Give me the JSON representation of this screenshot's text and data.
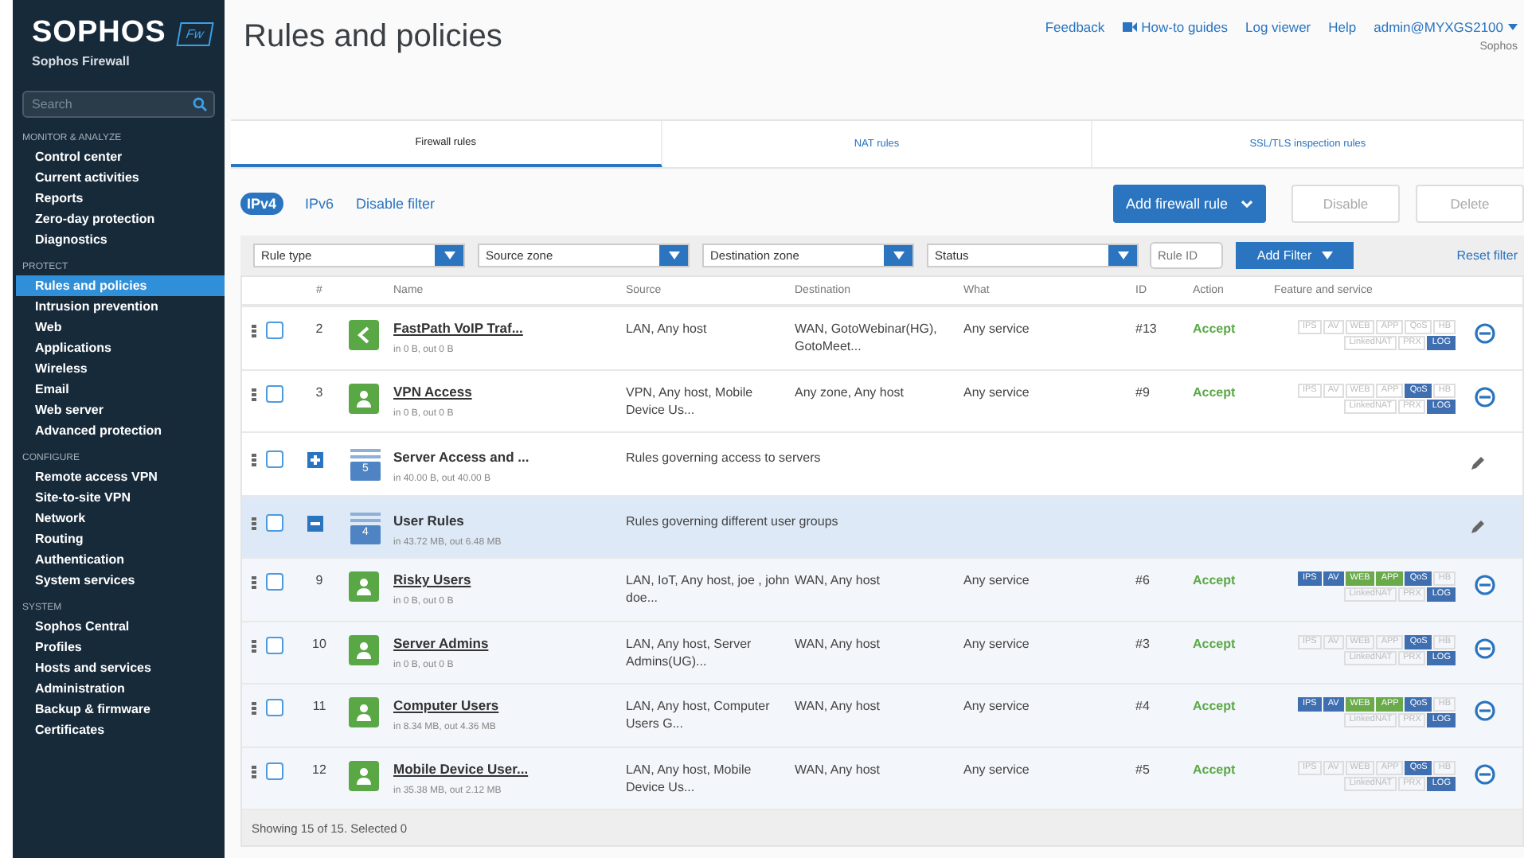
{
  "sidebar": {
    "logo": "SOPHOS",
    "badge": "Fw",
    "product": "Sophos Firewall",
    "search": {
      "placeholder": "Search"
    },
    "sections": [
      {
        "title": "MONITOR & ANALYZE",
        "items": [
          {
            "label": "Control center",
            "selected": false
          },
          {
            "label": "Current activities",
            "selected": false
          },
          {
            "label": "Reports",
            "selected": false
          },
          {
            "label": "Zero-day protection",
            "selected": false
          },
          {
            "label": "Diagnostics",
            "selected": false
          }
        ]
      },
      {
        "title": "PROTECT",
        "items": [
          {
            "label": "Rules and policies",
            "selected": true
          },
          {
            "label": "Intrusion prevention",
            "selected": false
          },
          {
            "label": "Web",
            "selected": false
          },
          {
            "label": "Applications",
            "selected": false
          },
          {
            "label": "Wireless",
            "selected": false
          },
          {
            "label": "Email",
            "selected": false
          },
          {
            "label": "Web server",
            "selected": false
          },
          {
            "label": "Advanced protection",
            "selected": false
          }
        ]
      },
      {
        "title": "CONFIGURE",
        "items": [
          {
            "label": "Remote access VPN",
            "selected": false
          },
          {
            "label": "Site-to-site VPN",
            "selected": false
          },
          {
            "label": "Network",
            "selected": false
          },
          {
            "label": "Routing",
            "selected": false
          },
          {
            "label": "Authentication",
            "selected": false
          },
          {
            "label": "System services",
            "selected": false
          }
        ]
      },
      {
        "title": "SYSTEM",
        "items": [
          {
            "label": "Sophos Central",
            "selected": false
          },
          {
            "label": "Profiles",
            "selected": false
          },
          {
            "label": "Hosts and services",
            "selected": false
          },
          {
            "label": "Administration",
            "selected": false
          },
          {
            "label": "Backup & firmware",
            "selected": false
          },
          {
            "label": "Certificates",
            "selected": false
          }
        ]
      }
    ]
  },
  "header": {
    "title": "Rules and policies",
    "links": [
      {
        "label": "Feedback",
        "kind": "plain"
      },
      {
        "label": "How-to guides",
        "kind": "video"
      },
      {
        "label": "Log viewer",
        "kind": "plain"
      },
      {
        "label": "Help",
        "kind": "plain"
      }
    ],
    "user": "admin@MYXGS2100",
    "company": "Sophos"
  },
  "tabs": [
    {
      "label": "Firewall rules",
      "selected": true
    },
    {
      "label": "NAT rules",
      "selected": false
    },
    {
      "label": "SSL/TLS inspection rules",
      "selected": false
    }
  ],
  "toolbar": {
    "ip_versions": [
      {
        "label": "IPv4",
        "selected": true
      },
      {
        "label": "IPv6",
        "selected": false
      }
    ],
    "disable_filter": "Disable filter",
    "add_button": "Add firewall rule",
    "buttons": [
      {
        "label": "Disable",
        "disabled": true
      },
      {
        "label": "Delete",
        "disabled": true
      }
    ]
  },
  "filters": {
    "dropdowns": [
      "Rule type",
      "Source zone",
      "Destination zone",
      "Status"
    ],
    "rule_id": {
      "placeholder": "Rule ID"
    },
    "add_filter": "Add Filter",
    "reset": "Reset filter"
  },
  "table": {
    "columns": [
      "#",
      "Name",
      "Source",
      "Destination",
      "What",
      "ID",
      "Action",
      "Feature and service"
    ],
    "rows": [
      {
        "kind": "network-rule",
        "checked": false,
        "number": "2",
        "name": "FastPath VoIP Traf...",
        "stats": "in 0 B, out 0 B",
        "source": "LAN, Any host",
        "destination": "WAN, GotoWebinar(HG), GotoMeet...",
        "what": "Any service",
        "id": "#13",
        "action": "Accept",
        "features_top": [
          {
            "label": "IPS",
            "on": false
          },
          {
            "label": "AV",
            "on": false
          },
          {
            "label": "WEB",
            "on": false
          },
          {
            "label": "APP",
            "on": false
          },
          {
            "label": "QoS",
            "on": false
          },
          {
            "label": "HB",
            "on": false
          }
        ],
        "features_bottom": [
          {
            "label": "LinkedNAT",
            "on": false
          },
          {
            "label": "PRX",
            "on": false
          },
          {
            "label": "LOG",
            "on": true,
            "color": "#3f6fb0"
          }
        ]
      },
      {
        "kind": "user-rule",
        "checked": false,
        "number": "3",
        "name": "VPN Access",
        "stats": "in 0 B, out 0 B",
        "source": "VPN, Any host, Mobile Device Us...",
        "destination": "Any zone, Any host",
        "what": "Any service",
        "id": "#9",
        "action": "Accept",
        "features_top": [
          {
            "label": "IPS",
            "on": false
          },
          {
            "label": "AV",
            "on": false
          },
          {
            "label": "WEB",
            "on": false
          },
          {
            "label": "APP",
            "on": false
          },
          {
            "label": "QoS",
            "on": true,
            "color": "#3f6fb0"
          },
          {
            "label": "HB",
            "on": false
          }
        ],
        "features_bottom": [
          {
            "label": "LinkedNAT",
            "on": false
          },
          {
            "label": "PRX",
            "on": false
          },
          {
            "label": "LOG",
            "on": true,
            "color": "#3f6fb0"
          }
        ]
      },
      {
        "kind": "group",
        "checked": false,
        "expanded": false,
        "selected": false,
        "count": "5",
        "name": "Server Access and ...",
        "stats": "in 40.00 B, out 40.00 B",
        "description": "Rules governing access to servers"
      },
      {
        "kind": "group",
        "checked": false,
        "expanded": true,
        "selected": true,
        "count": "4",
        "name": "User Rules",
        "stats": "in 43.72 MB, out 6.48 MB",
        "description": "Rules governing different user groups",
        "children": [
          {
            "kind": "user-rule",
            "checked": false,
            "number": "9",
            "name": "Risky Users",
            "stats": "in 0 B, out 0 B",
            "source": "LAN, IoT, Any host, joe , john doe...",
            "destination": "WAN, Any host",
            "what": "Any service",
            "id": "#6",
            "action": "Accept",
            "features_top": [
              {
                "label": "IPS",
                "on": true,
                "color": "#3f6fb0"
              },
              {
                "label": "AV",
                "on": true,
                "color": "#3f6fb0"
              },
              {
                "label": "WEB",
                "on": true,
                "color": "#6aaa4a"
              },
              {
                "label": "APP",
                "on": true,
                "color": "#6aaa4a"
              },
              {
                "label": "QoS",
                "on": true,
                "color": "#3f6fb0"
              },
              {
                "label": "HB",
                "on": false
              }
            ],
            "features_bottom": [
              {
                "label": "LinkedNAT",
                "on": false
              },
              {
                "label": "PRX",
                "on": false
              },
              {
                "label": "LOG",
                "on": true,
                "color": "#3f6fb0"
              }
            ]
          },
          {
            "kind": "user-rule",
            "checked": false,
            "number": "10",
            "name": "Server Admins",
            "stats": "in 0 B, out 0 B",
            "source": "LAN, Any host, Server Admins(UG)...",
            "destination": "WAN, Any host",
            "what": "Any service",
            "id": "#3",
            "action": "Accept",
            "features_top": [
              {
                "label": "IPS",
                "on": false
              },
              {
                "label": "AV",
                "on": false
              },
              {
                "label": "WEB",
                "on": false
              },
              {
                "label": "APP",
                "on": false
              },
              {
                "label": "QoS",
                "on": true,
                "color": "#3f6fb0"
              },
              {
                "label": "HB",
                "on": false
              }
            ],
            "features_bottom": [
              {
                "label": "LinkedNAT",
                "on": false
              },
              {
                "label": "PRX",
                "on": false
              },
              {
                "label": "LOG",
                "on": true,
                "color": "#3f6fb0"
              }
            ]
          },
          {
            "kind": "user-rule",
            "checked": false,
            "number": "11",
            "name": "Computer Users",
            "stats": "in 8.34 MB, out 4.36 MB",
            "source": "LAN, Any host, Computer Users G...",
            "destination": "WAN, Any host",
            "what": "Any service",
            "id": "#4",
            "action": "Accept",
            "features_top": [
              {
                "label": "IPS",
                "on": true,
                "color": "#3f6fb0"
              },
              {
                "label": "AV",
                "on": true,
                "color": "#3f6fb0"
              },
              {
                "label": "WEB",
                "on": true,
                "color": "#6aaa4a"
              },
              {
                "label": "APP",
                "on": true,
                "color": "#6aaa4a"
              },
              {
                "label": "QoS",
                "on": true,
                "color": "#3f6fb0"
              },
              {
                "label": "HB",
                "on": false
              }
            ],
            "features_bottom": [
              {
                "label": "LinkedNAT",
                "on": false
              },
              {
                "label": "PRX",
                "on": false
              },
              {
                "label": "LOG",
                "on": true,
                "color": "#3f6fb0"
              }
            ]
          },
          {
            "kind": "user-rule",
            "checked": false,
            "number": "12",
            "name": "Mobile Device User...",
            "stats": "in 35.38 MB, out 2.12 MB",
            "source": "LAN, Any host, Mobile Device Us...",
            "destination": "WAN, Any host",
            "what": "Any service",
            "id": "#5",
            "action": "Accept",
            "features_top": [
              {
                "label": "IPS",
                "on": false
              },
              {
                "label": "AV",
                "on": false
              },
              {
                "label": "WEB",
                "on": false
              },
              {
                "label": "APP",
                "on": false
              },
              {
                "label": "QoS",
                "on": true,
                "color": "#3f6fb0"
              },
              {
                "label": "HB",
                "on": false
              }
            ],
            "features_bottom": [
              {
                "label": "LinkedNAT",
                "on": false
              },
              {
                "label": "PRX",
                "on": false
              },
              {
                "label": "LOG",
                "on": true,
                "color": "#3f6fb0"
              }
            ]
          }
        ]
      }
    ],
    "footer": "Showing 15 of 15. Selected 0"
  }
}
